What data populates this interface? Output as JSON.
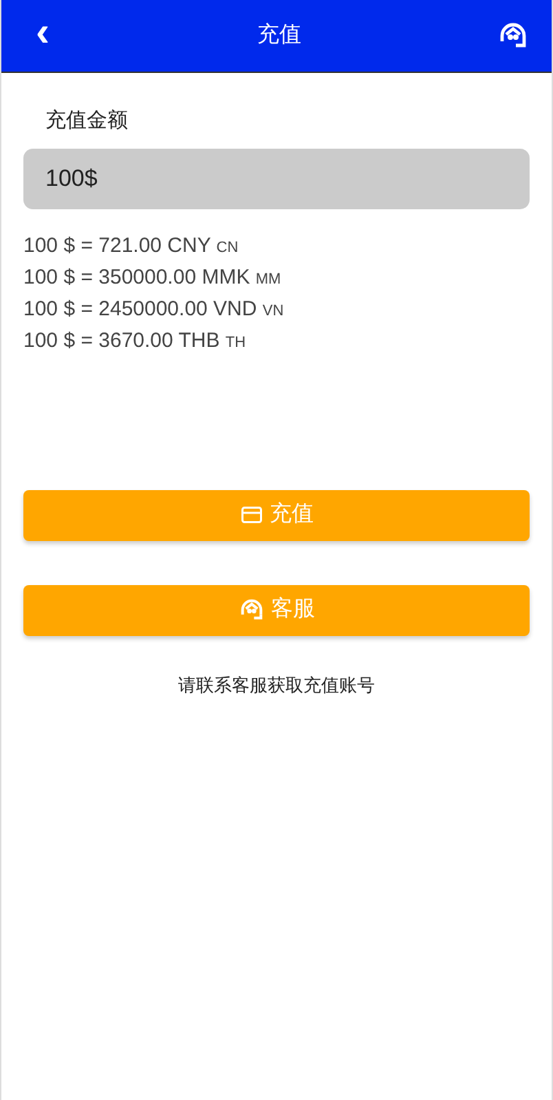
{
  "header": {
    "back": "‹",
    "title": "充值"
  },
  "amount": {
    "label": "充值金额",
    "value": "100$"
  },
  "rates": [
    {
      "text": "100 $ = 721.00 CNY",
      "code": "CN"
    },
    {
      "text": "100 $ = 350000.00 MMK",
      "code": "MM"
    },
    {
      "text": "100 $ = 2450000.00 VND",
      "code": "VN"
    },
    {
      "text": "100 $ = 3670.00 THB",
      "code": "TH"
    }
  ],
  "buttons": [
    {
      "kind": "recharge",
      "label": "充值"
    },
    {
      "kind": "service",
      "label": "客服"
    }
  ],
  "note": "请联系客服获取充值账号"
}
